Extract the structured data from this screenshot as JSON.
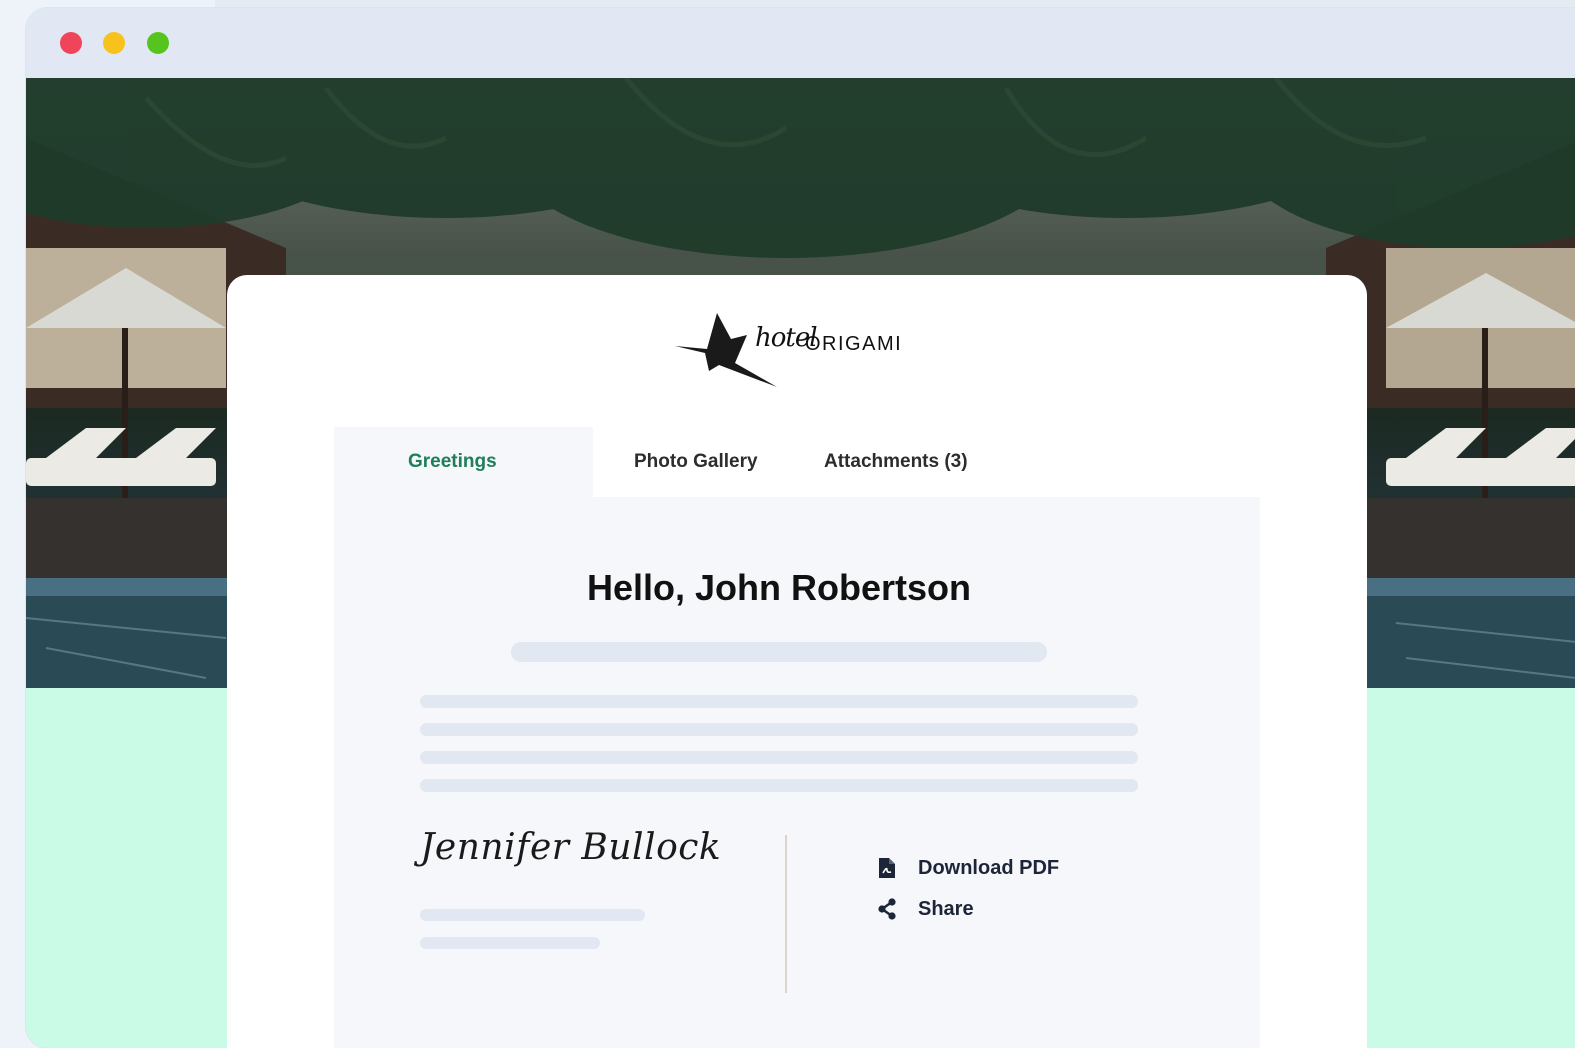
{
  "window": {
    "controls": [
      "close",
      "minimize",
      "maximize"
    ]
  },
  "brand": {
    "logo_script": "hotel",
    "logo_word": "ORIGAMI",
    "logo_icon": "origami-bird-icon"
  },
  "tabs": [
    {
      "label": "Greetings",
      "active": true
    },
    {
      "label": "Photo Gallery",
      "active": false
    },
    {
      "label": "Attachments (3)",
      "active": false
    }
  ],
  "main": {
    "greeting": "Hello, John Robertson",
    "signature": "Jennifer Bullock"
  },
  "actions": {
    "download": {
      "label": "Download PDF",
      "icon": "pdf-file-icon"
    },
    "share": {
      "label": "Share",
      "icon": "share-icon"
    }
  },
  "colors": {
    "active_tab": "#1f7d57",
    "mint_background": "#c9fbe6",
    "close_dot": "#f0445b",
    "minimize_dot": "#f7c21b",
    "maximize_dot": "#55c41e"
  }
}
